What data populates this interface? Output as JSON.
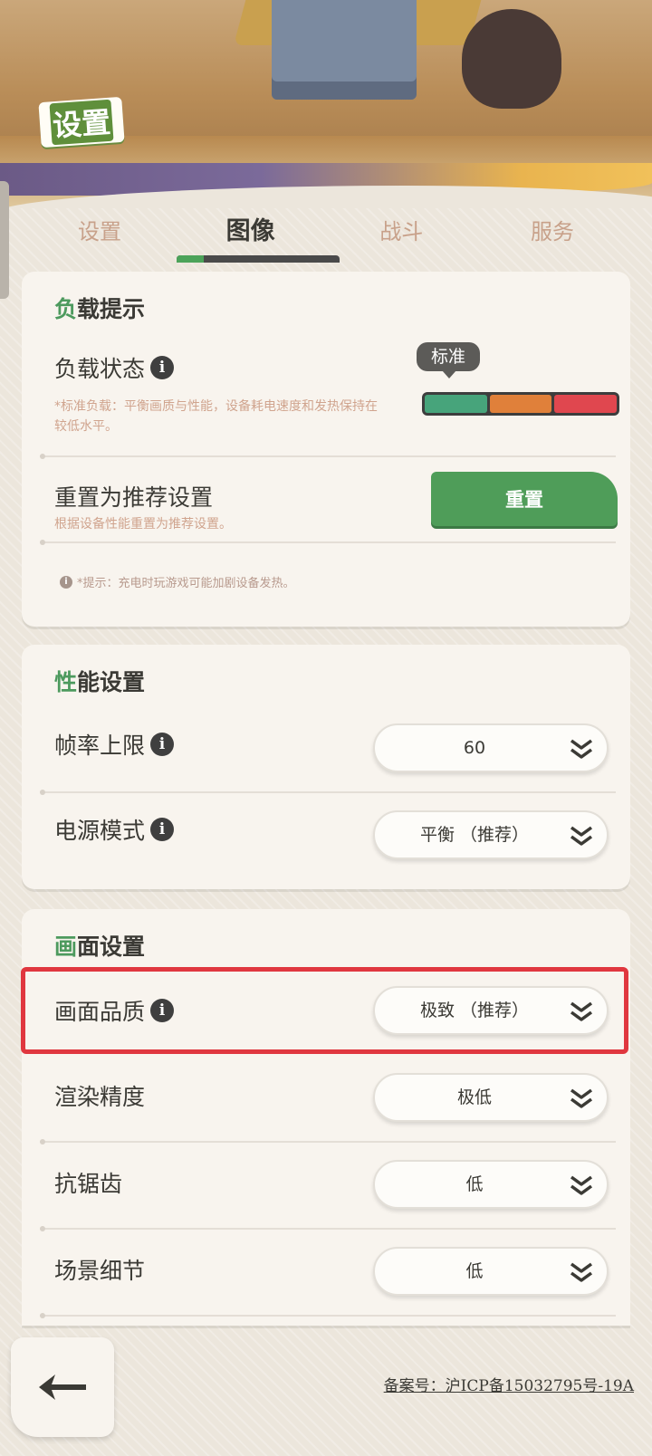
{
  "page_title": "设置",
  "tabs": [
    {
      "label": "设置",
      "active": false
    },
    {
      "label": "图像",
      "active": true
    },
    {
      "label": "战斗",
      "active": false
    },
    {
      "label": "服务",
      "active": false
    }
  ],
  "load_section": {
    "title_accent": "负",
    "title_rest": "载提示",
    "load_status": {
      "label": "负载状态",
      "description": "*标准负载：平衡画质与性能，设备耗电速度和发热保持在较低水平。",
      "current_level": "标准",
      "meter_colors": [
        "#47a47b",
        "#e0803a",
        "#e0474f"
      ]
    },
    "reset": {
      "label": "重置为推荐设置",
      "description": "根据设备性能重置为推荐设置。",
      "button_label": "重置"
    },
    "tip": "*提示：充电时玩游戏可能加剧设备发热。"
  },
  "performance_section": {
    "title_accent": "性",
    "title_rest": "能设置",
    "frame_rate": {
      "label": "帧率上限",
      "value": "60"
    },
    "power_mode": {
      "label": "电源模式",
      "value": "平衡 （推荐）"
    }
  },
  "graphics_section": {
    "title_accent": "画",
    "title_rest": "面设置",
    "quality": {
      "label": "画面品质",
      "value": "极致 （推荐）"
    },
    "render": {
      "label": "渲染精度",
      "value": "极低"
    },
    "antialias": {
      "label": "抗锯齿",
      "value": "低"
    },
    "scene_detail": {
      "label": "场景细节",
      "value": "低"
    }
  },
  "footer": {
    "icp": "备案号：沪ICP备15032795号-19A"
  },
  "colors": {
    "accent_green": "#4f9d59",
    "highlight_red": "#e0373f"
  }
}
